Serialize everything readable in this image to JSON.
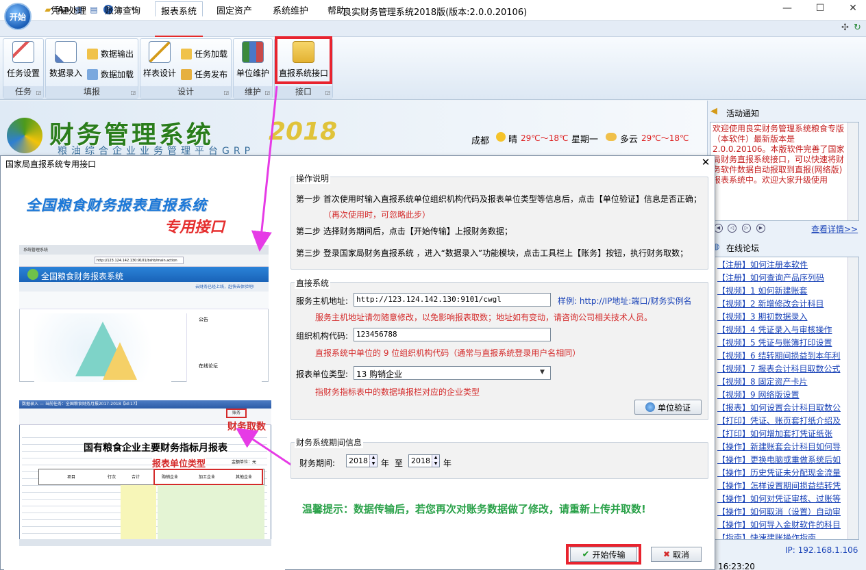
{
  "window": {
    "start_button": "开始",
    "title": "良实财务管理系统2018版(版本:2.0.0.20106)",
    "minimize": "—",
    "maximize": "☐",
    "close": "✕"
  },
  "quick_access": [
    "folder-icon",
    "font-icon",
    "layout-icon",
    "table-icon",
    "help-icon",
    "more-icon"
  ],
  "menu": {
    "items": [
      "凭证处理",
      "账簿查询",
      "报表系统",
      "固定资产",
      "系统维护",
      "帮助"
    ],
    "active": "报表系统"
  },
  "ribbon": {
    "groups": [
      {
        "label": "任务",
        "buttons": [
          "任务设置"
        ]
      },
      {
        "label": "填报",
        "buttons": [
          "数据录入",
          "数据输出",
          "数据加载"
        ]
      },
      {
        "label": "设计",
        "buttons": [
          "样表设计",
          "任务加载",
          "任务发布"
        ]
      },
      {
        "label": "维护",
        "buttons": [
          "单位维护"
        ]
      },
      {
        "label": "接口",
        "buttons": [
          "直报系统接口"
        ]
      }
    ]
  },
  "banner": {
    "logo_title": "财务管理系统",
    "logo_year": "2018",
    "logo_subtitle": "粮油综合企业业务管理平台GRP"
  },
  "weather": {
    "city": "成都",
    "today": "晴",
    "today_temp": "29℃～18℃",
    "weekday": "星期一",
    "tomorrow": "多云",
    "tomorrow_temp": "29℃～18℃"
  },
  "right_panel": {
    "notice_title": "活动通知",
    "notice_text": "欢迎使用良实财务管理系统粮食专版（本软件）最新版本是2.0.0.20106。本版软件完善了国家局财务直报系统接口，可以快速将财务软件数据自动报取到直报(网络版)报表系统中。欢迎大家升级使用",
    "more_link": "查看详情>>",
    "forum_title": "在线论坛",
    "forum_items": [
      "【注册】如何注册本软件",
      "【注册】如何查询产品序列码",
      "【视频】1 如何新建账套",
      "【视频】2 新增修改会计科目",
      "【视频】3 期初数据录入",
      "【视频】4 凭证录入与审核操作",
      "【视频】5 凭证与账簿打印设置",
      "【视频】6 结转期间损益到本年利",
      "【视频】7 报表会计科目取数公式",
      "【视频】8 固定资产卡片",
      "【视频】9 网络版设置",
      "【报表】如何设置会计科目取数公",
      "【打印】凭证、账页套打纸介绍及",
      "【打印】如何增加套打凭证纸张",
      "【操作】新建账套会计科目如何导",
      "【操作】更换电脑或重做系统后如",
      "【操作】历史凭证未分配现金流量",
      "【操作】怎样设置期间损益结转凭",
      "【操作】如何对凭证审核、过账等",
      "【操作】如何取消（设置）自动审",
      "【操作】如何导入金财软件的科目",
      "【指南】快速建账操作指南"
    ],
    "ip": "IP: 192.168.1.106",
    "clock": "16:23:20"
  },
  "dialog": {
    "title": "国家局直报系统专用接口",
    "close": "✕",
    "promo_title": "全国粮食财务报表直报系统",
    "promo_subtitle": "专用接口",
    "shot1": {
      "tab": "系统管理系统",
      "url": "http://123.124.142.130:9101/bshb/main.action",
      "system_name": "全国粮食财务报表系统",
      "notice": "云财务已经上线，赶快去体验吧!",
      "side_notice": "公告",
      "side_forum": "在线论坛"
    },
    "shot2": {
      "title": "数据录入 — 当前任务：全国粮食财务月报2017-2018【id:17】",
      "fetch_button": "账务",
      "annotation_fetch": "财务取数",
      "sheet_title": "国有粮食企业主要财务指标月报表",
      "annotation_type": "报表单位类型",
      "unit": "金额单位：元",
      "headers": [
        "项目",
        "行次",
        "合计",
        "购销企业",
        "加工企业",
        "其他企业"
      ]
    },
    "ops": {
      "legend": "操作说明",
      "step1": "第一步  首次使用时输入直报系统单位组织机构代码及报表单位类型等信息后，点击【单位验证】信息是否正确；",
      "step1_note": "（再次使用时，可忽略此步）",
      "step2": "第二步  选择财务期间后，点击【开始传输】上报财务数据；",
      "step3": "第三步  登录国家局财务直报系统 ，进入“数据录入”功能模块，点击工具栏上【账务】按钮，执行财务取数；"
    },
    "direct": {
      "legend": "直接系统",
      "host_label": "服务主机地址:",
      "host_value": "http://123.124.142.130:9101/cwgl",
      "host_example": "样例: http://IP地址:端口/财务实例名",
      "host_warn": "服务主机地址请勿随意修改，以免影响报表取数；地址如有变动，请咨询公司相关技术人员。",
      "org_label": "组织机构代码:",
      "org_value": "123456788",
      "org_warn": "直报系统中单位的 9 位组织机构代码（通常与直报系统登录用户名相同）",
      "type_label": "报表单位类型:",
      "type_value": "13 购销企业",
      "type_warn": "指财务指标表中的数据填报栏对应的企业类型",
      "verify_button": "单位验证"
    },
    "period": {
      "legend": "财务系统期间信息",
      "label": "财务期间:",
      "from": "2018",
      "to": "2018",
      "year_unit": "年",
      "to_word": "至"
    },
    "tip": "温馨提示：数据传输后，若您再次对账务数据做了修改，请重新上传并取数!",
    "start_button": "开始传输",
    "cancel_button": "取消"
  },
  "colors": {
    "highlight": "#e8232e",
    "arrow": "#e63be6",
    "warn_text": "#d42a2a",
    "tip_text": "#2ba24a",
    "link": "#1b44b8"
  }
}
